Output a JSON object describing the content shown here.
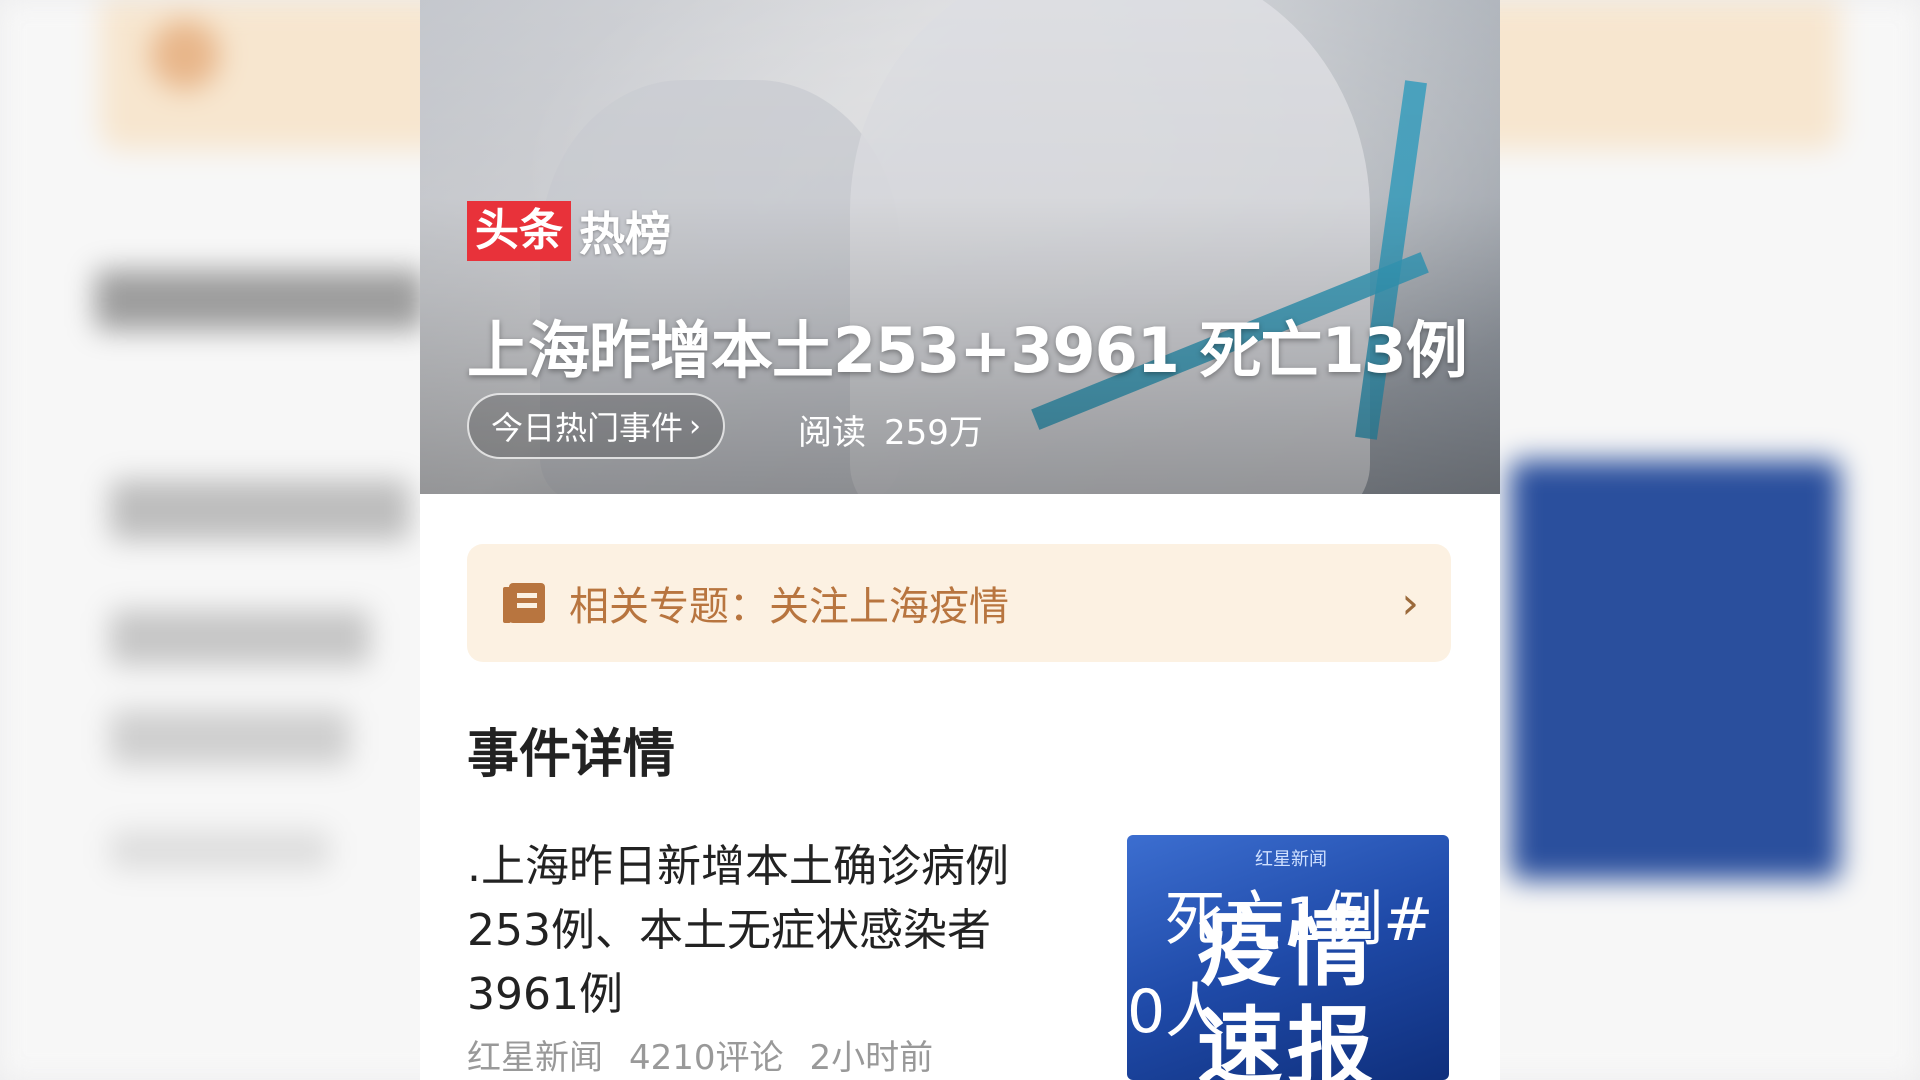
{
  "hero": {
    "logo_box": "头条",
    "logo_text": "热榜",
    "title": "上海昨增本土253+3961  死亡13例",
    "tag_label": "今日热门事件",
    "tag_chevron": "›",
    "reads_label": "阅读",
    "reads_value": "259万"
  },
  "topic": {
    "icon": "book-icon",
    "label": "相关专题：关注上海疫情",
    "arrow": "›"
  },
  "section": {
    "title": "事件详情"
  },
  "news": {
    "headline": ".上海昨日新增本土确诊病例253例、本土无症状感染者3961例",
    "source": "红星新闻",
    "comments": "4210评论",
    "time": "2小时前",
    "thumb": {
      "source_logo": "红星新闻",
      "big_line1": "疫情",
      "big_line2": "速报",
      "overlay_line1": "死亡1例#",
      "overlay_line2": "0人"
    }
  }
}
